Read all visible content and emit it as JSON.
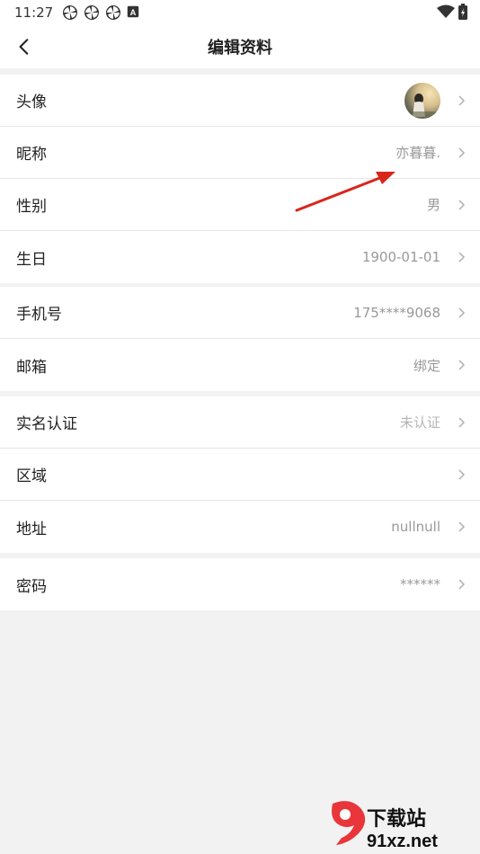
{
  "status_bar": {
    "time": "11:27",
    "notification_icons": [
      "pinwheel-icon",
      "pinwheel-icon",
      "pinwheel-icon",
      "a-box-icon"
    ],
    "right_icons": [
      "wifi-icon",
      "battery-icon"
    ]
  },
  "header": {
    "title": "编辑资料",
    "back_icon": "back-arrow-icon"
  },
  "sections": [
    {
      "rows": [
        {
          "label": "头像",
          "value": "",
          "type": "avatar"
        },
        {
          "label": "昵称",
          "value": "亦暮暮."
        },
        {
          "label": "性别",
          "value": "男"
        },
        {
          "label": "生日",
          "value": "1900-01-01"
        }
      ]
    },
    {
      "rows": [
        {
          "label": "手机号",
          "value": "175****9068"
        },
        {
          "label": "邮箱",
          "value": "绑定"
        }
      ]
    },
    {
      "rows": [
        {
          "label": "实名认证",
          "value": "未认证"
        },
        {
          "label": "区域",
          "value": ""
        },
        {
          "label": "地址",
          "value": "nullnull"
        }
      ]
    },
    {
      "rows": [
        {
          "label": "密码",
          "value": "******"
        }
      ]
    }
  ],
  "watermark": {
    "text": "下载站",
    "domain": "91xz.net",
    "accent": "#e8363a"
  },
  "colors": {
    "background": "#f2f2f2",
    "label": "#222222",
    "value": "#999999",
    "annotation_arrow": "#d9261c"
  }
}
